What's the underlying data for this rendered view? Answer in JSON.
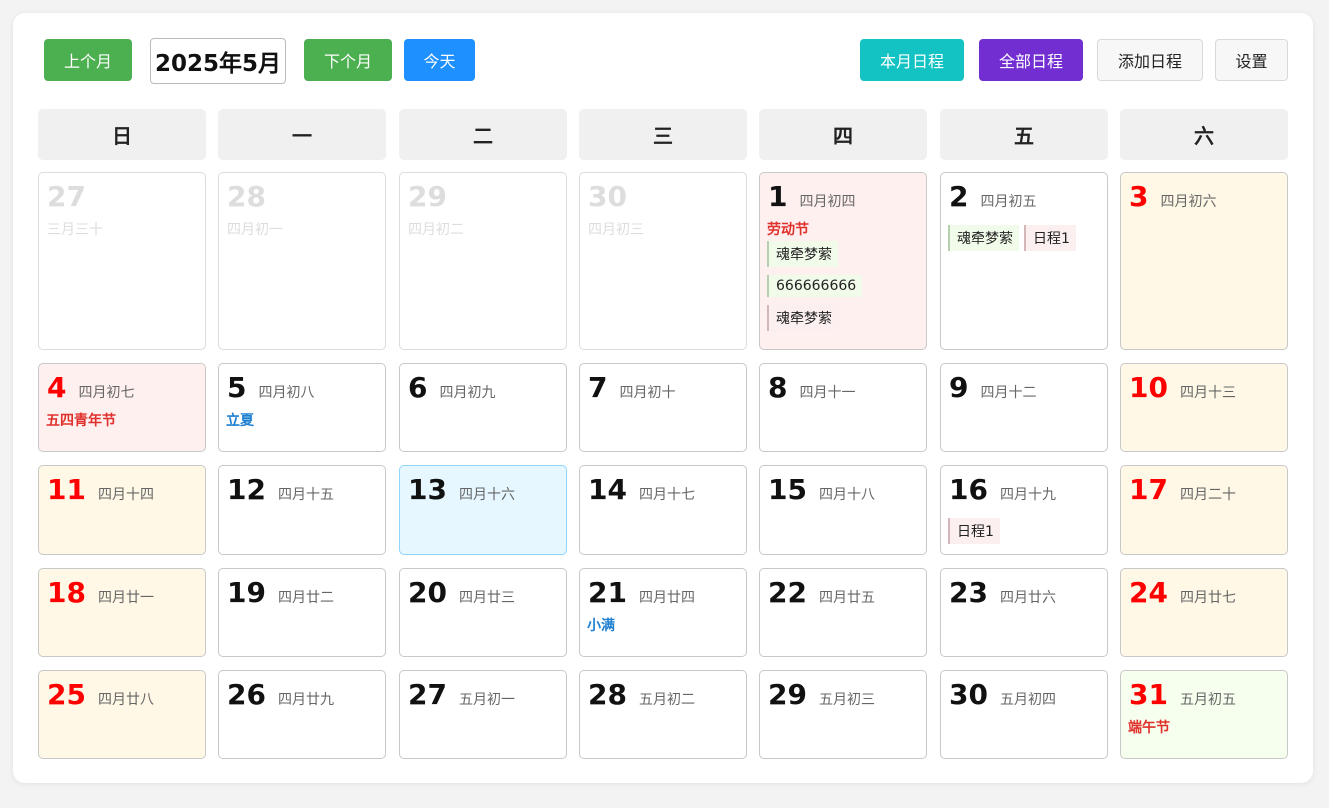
{
  "toolbar": {
    "prev_label": "上个月",
    "month_title": "2025年5月",
    "next_label": "下个月",
    "today_label": "今天",
    "month_schedule_label": "本月日程",
    "all_schedule_label": "全部日程",
    "add_schedule_label": "添加日程",
    "settings_label": "设置"
  },
  "colors": {
    "green": "#4caf50",
    "blue": "#1e90ff",
    "teal": "#13c2c2",
    "purple": "#722ed1",
    "weekend_bg": "#fff8e6",
    "holiday_bg": "#fff0f0",
    "today_bg": "#e6f7ff",
    "festival_red": "#e0302c",
    "term_blue": "#1e7fd1"
  },
  "weekdays": [
    "日",
    "一",
    "二",
    "三",
    "四",
    "五",
    "六"
  ],
  "days": [
    {
      "num": "27",
      "lunar": "三月三十",
      "other": true
    },
    {
      "num": "28",
      "lunar": "四月初一",
      "other": true
    },
    {
      "num": "29",
      "lunar": "四月初二",
      "other": true
    },
    {
      "num": "30",
      "lunar": "四月初三",
      "other": true
    },
    {
      "num": "1",
      "lunar": "四月初四",
      "festival": "劳动节",
      "events": [
        "魂牵梦萦",
        "666666666",
        "魂牵梦萦"
      ]
    },
    {
      "num": "2",
      "lunar": "四月初五",
      "events": [
        "魂牵梦萦",
        "日程1"
      ]
    },
    {
      "num": "3",
      "lunar": "四月初六"
    },
    {
      "num": "4",
      "lunar": "四月初七",
      "festival": "五四青年节"
    },
    {
      "num": "5",
      "lunar": "四月初八",
      "term": "立夏"
    },
    {
      "num": "6",
      "lunar": "四月初九"
    },
    {
      "num": "7",
      "lunar": "四月初十"
    },
    {
      "num": "8",
      "lunar": "四月十一"
    },
    {
      "num": "9",
      "lunar": "四月十二"
    },
    {
      "num": "10",
      "lunar": "四月十三"
    },
    {
      "num": "11",
      "lunar": "四月十四"
    },
    {
      "num": "12",
      "lunar": "四月十五"
    },
    {
      "num": "13",
      "lunar": "四月十六"
    },
    {
      "num": "14",
      "lunar": "四月十七"
    },
    {
      "num": "15",
      "lunar": "四月十八"
    },
    {
      "num": "16",
      "lunar": "四月十九",
      "events": [
        "日程1"
      ]
    },
    {
      "num": "17",
      "lunar": "四月二十"
    },
    {
      "num": "18",
      "lunar": "四月廿一"
    },
    {
      "num": "19",
      "lunar": "四月廿二"
    },
    {
      "num": "20",
      "lunar": "四月廿三"
    },
    {
      "num": "21",
      "lunar": "四月廿四",
      "term": "小满"
    },
    {
      "num": "22",
      "lunar": "四月廿五"
    },
    {
      "num": "23",
      "lunar": "四月廿六"
    },
    {
      "num": "24",
      "lunar": "四月廿七"
    },
    {
      "num": "25",
      "lunar": "四月廿八"
    },
    {
      "num": "26",
      "lunar": "四月廿九"
    },
    {
      "num": "27",
      "lunar": "五月初一"
    },
    {
      "num": "28",
      "lunar": "五月初二"
    },
    {
      "num": "29",
      "lunar": "五月初三"
    },
    {
      "num": "30",
      "lunar": "五月初四"
    },
    {
      "num": "31",
      "lunar": "五月初五",
      "festival": "端午节"
    }
  ]
}
